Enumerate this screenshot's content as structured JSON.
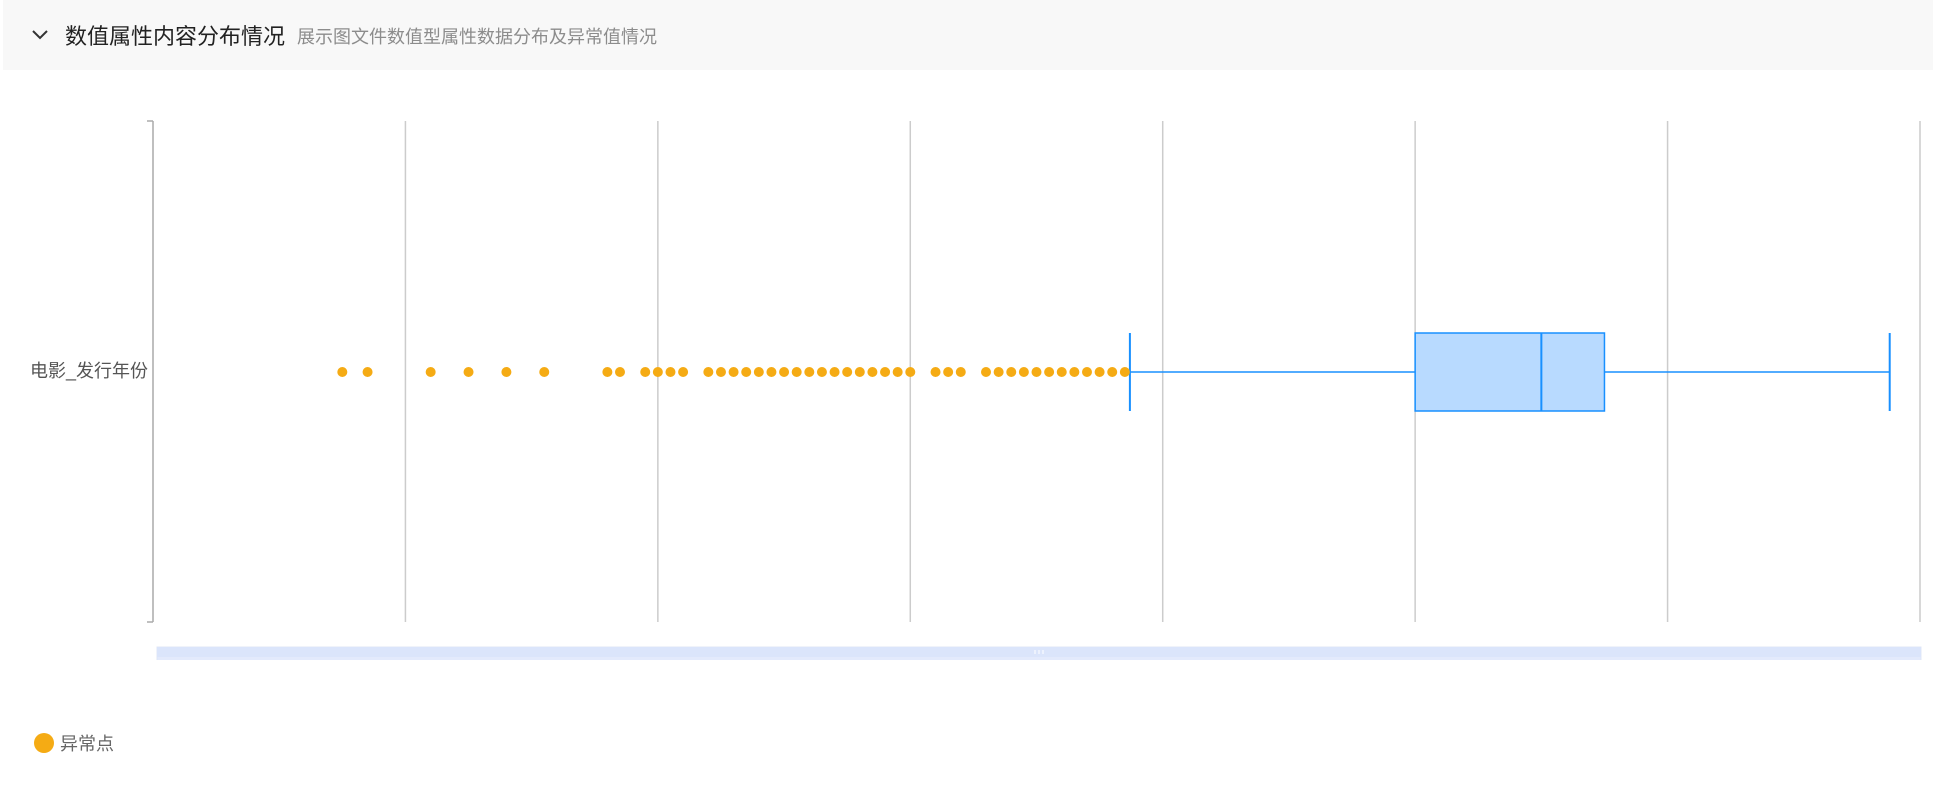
{
  "header": {
    "title": "数值属性内容分布情况",
    "subtitle": "展示图文件数值型属性数据分布及异常值情况",
    "toggle_icon": "chevron-down-icon"
  },
  "colors": {
    "box_fill": "#b8daff",
    "box_stroke": "#1890ff",
    "outlier": "#f5ab14",
    "grid": "#cccccc",
    "slider_fill": "#dbe5fb"
  },
  "legend": {
    "label": "异常点"
  },
  "chart_data": {
    "type": "boxplot",
    "orientation": "horizontal",
    "category": "电影_发行年份",
    "xlim": [
      0,
      7
    ],
    "xtick_labels": [],
    "grid": true,
    "legend_position": "bottom-left",
    "box": {
      "whisker_low": 3.87,
      "q1": 5.0,
      "median": 5.5,
      "q3": 5.75,
      "whisker_high": 6.88
    },
    "outliers": [
      0.75,
      0.85,
      1.1,
      1.25,
      1.4,
      1.55,
      1.8,
      1.85,
      1.95,
      2.0,
      2.05,
      2.1,
      2.2,
      2.25,
      2.3,
      2.35,
      2.4,
      2.45,
      2.5,
      2.55,
      2.6,
      2.65,
      2.7,
      2.75,
      2.8,
      2.85,
      2.9,
      2.95,
      3.0,
      3.1,
      3.15,
      3.2,
      3.3,
      3.35,
      3.4,
      3.45,
      3.5,
      3.55,
      3.6,
      3.65,
      3.7,
      3.75,
      3.8,
      3.85
    ],
    "outlier_series_name": "异常点",
    "zoom_range": [
      0,
      1
    ]
  }
}
